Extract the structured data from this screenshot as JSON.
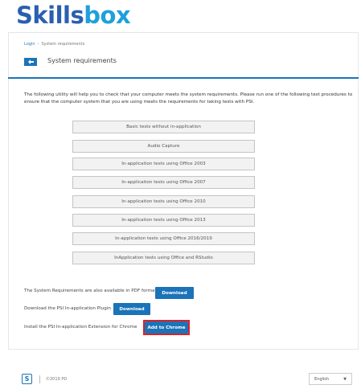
{
  "brand": {
    "logo_part1": "Skills",
    "logo_part2": "box"
  },
  "breadcrumb": {
    "items": [
      "Login",
      "System requirements"
    ],
    "separator": "›"
  },
  "header": {
    "back_icon": "arrow-left-icon",
    "title": "System requirements"
  },
  "intro": "The following utility will help you to check that your computer meets the system requirements. Please run one of the following test procedures to ensure that the computer system that you are using meets the requirements for taking tests with PSI.",
  "tests": [
    "Basic tests without in-application",
    "Audio Capture",
    "In-application tests using Office 2003",
    "In-application tests using Office 2007",
    "In-application tests using Office 2010",
    "In-application tests using Office 2013",
    "In-application tests using Office 2016/2019",
    "InApplication tests using Office and RStudio"
  ],
  "downloads": [
    {
      "text": "The System Requirements are also available in PDF format",
      "button": "Download"
    },
    {
      "text": "Download the PSI In-application Plugin",
      "button": "Download"
    },
    {
      "text": "Install the PSI In-application Extension for Chrome",
      "button": "Add to Chrome"
    }
  ],
  "footer": {
    "logo_letter": "S",
    "copyright": "©2019 PD",
    "language": "English",
    "caret_icon": "chevron-down-icon"
  },
  "colors": {
    "brand_dark": "#2a5fb0",
    "brand_light": "#1ea0dc",
    "accent": "#1b73b8",
    "highlight": "#d9222a"
  }
}
